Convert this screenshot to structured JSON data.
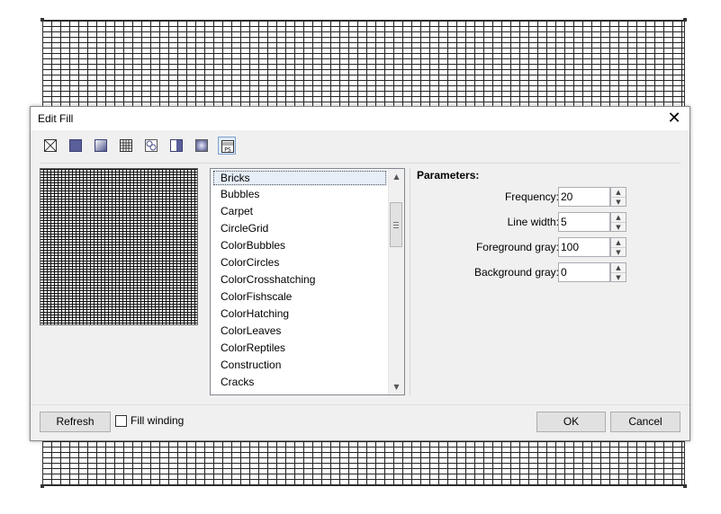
{
  "dialog": {
    "title": "Edit Fill",
    "close_glyph": "✕"
  },
  "fill_types": [
    {
      "icon": "no-fill-icon",
      "selected": false
    },
    {
      "icon": "uniform-fill-icon",
      "selected": false
    },
    {
      "icon": "fountain-fill-icon",
      "selected": false
    },
    {
      "icon": "pattern-fill-icon",
      "selected": false
    },
    {
      "icon": "spiral-pattern-icon",
      "selected": false
    },
    {
      "icon": "gradient-fill-icon",
      "selected": false
    },
    {
      "icon": "texture-fill-icon",
      "selected": false
    },
    {
      "icon": "postscript-fill-icon",
      "selected": true,
      "label": "PS"
    }
  ],
  "pattern_list": {
    "items": [
      "Bricks",
      "Bubbles",
      "Carpet",
      "CircleGrid",
      "ColorBubbles",
      "ColorCircles",
      "ColorCrosshatching",
      "ColorFishscale",
      "ColorHatching",
      "ColorLeaves",
      "ColorReptiles",
      "Construction",
      "Cracks"
    ],
    "selected": "Bricks"
  },
  "parameters": {
    "title": "Parameters:",
    "rows": [
      {
        "label": "Frequency:",
        "value": "20"
      },
      {
        "label": "Line width:",
        "value": "5"
      },
      {
        "label": "Foreground gray:",
        "value": "100"
      },
      {
        "label": "Background gray:",
        "value": "0"
      }
    ]
  },
  "buttons": {
    "refresh": "Refresh",
    "fill_winding": "Fill winding",
    "ok": "OK",
    "cancel": "Cancel"
  },
  "colors": {
    "accent": "#7da2ce",
    "dialog_bg": "#f0f0f0"
  }
}
